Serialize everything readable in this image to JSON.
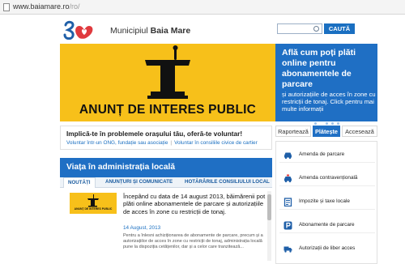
{
  "browser": {
    "url_main": "www.baiamare.ro",
    "url_rest": "/ro/"
  },
  "header": {
    "city_prefix": "Municipiul",
    "city_name": "Baia Mare",
    "search_placeholder": "",
    "search_button": "CAUTĂ"
  },
  "banner": {
    "title": "ANUNȚ DE INTERES PUBLIC"
  },
  "promo": {
    "title": "Află cum poți plăti online pentru abonamentele de parcare",
    "text": "și autorizațiile de acces în zone cu restricții de tonaj. Click pentru mai multe informații",
    "dots_total": 5,
    "dots_active": 1
  },
  "volunteer": {
    "title": "Implică-te în problemele orașului tău, oferă-te voluntar!",
    "link1": "Voluntar într-un ONG, fundație sau asociație",
    "separator": "|",
    "link2": "Voluntar în consiliile civice de cartier"
  },
  "section": {
    "title": "Viața în administrația locală",
    "tabs": [
      "NOUTĂȚI",
      "ANUNȚURI ȘI COMUNICATE",
      "HOTĂRÂRILE CONSILIULUI LOCAL"
    ]
  },
  "news": {
    "thumb_caption": "ANUNȚ DE INTERES PUBLIC",
    "headline": "Începând cu data de 14 august 2013, băimărenii pot plăti online abonamentele de parcare și autorizațiile de acces în zone cu restricții de tonaj.",
    "date": "14 August, 2013",
    "body": "Pentru a înlesni achiziționarea de abonamente de parcare, precum și a autorizațiilor de acces în zone cu restricții de tonaj, administrația locală pune la dispoziția cetățenilor, dar și a celor care tranzitează..."
  },
  "right_tabs": [
    "Raportează",
    "Plătește",
    "Accesează"
  ],
  "right_list": [
    {
      "icon": "car-icon",
      "label": "Amenda de parcare"
    },
    {
      "icon": "police-car-icon",
      "label": "Amenda contravențională"
    },
    {
      "icon": "tax-icon",
      "label": "Impozite și taxe locale"
    },
    {
      "icon": "parking-icon",
      "label": "Abonamente de parcare"
    },
    {
      "icon": "truck-icon",
      "label": "Autorizații de liber acces"
    }
  ],
  "colors": {
    "brand_blue": "#1f6fc4",
    "banner_yellow": "#f7c01a",
    "logo_red": "#e03a3e"
  }
}
